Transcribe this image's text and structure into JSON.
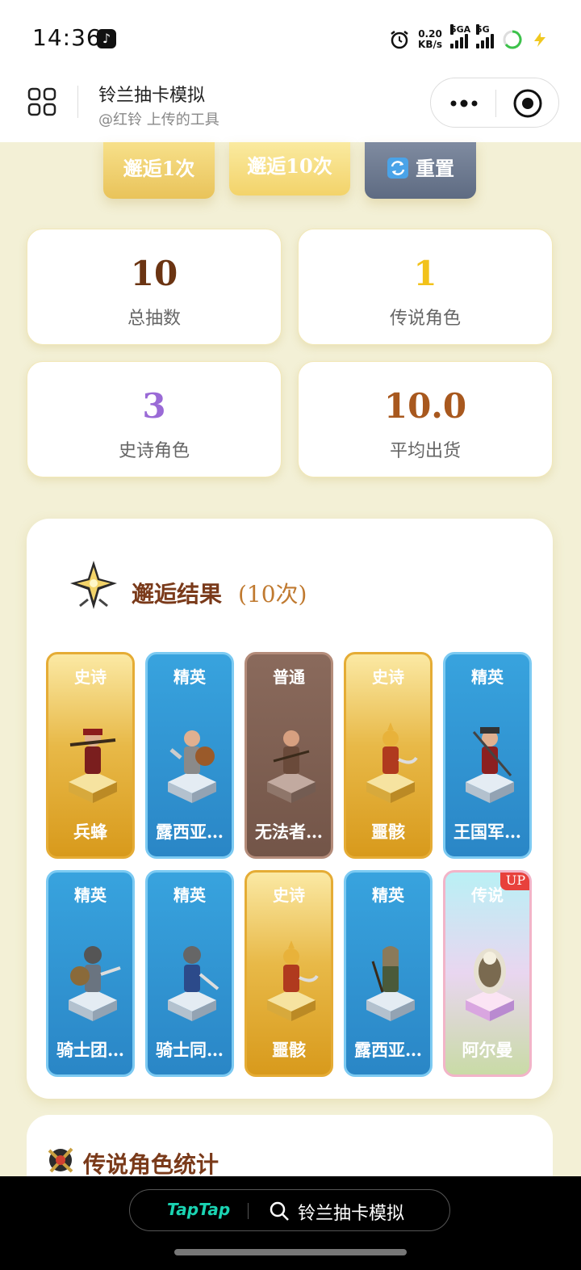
{
  "status_bar": {
    "time": "14:36",
    "net_speed_value": "0.20",
    "net_speed_unit": "KB/s",
    "sig1_label": "5GA",
    "sig2_label": "5G",
    "icons": [
      "tiktok-icon",
      "alarm-icon",
      "signal-icon",
      "battery-icon",
      "charging-icon"
    ]
  },
  "header": {
    "title": "铃兰抽卡模拟",
    "subtitle": "@红铃 上传的工具"
  },
  "actions": {
    "draw_one": "邂逅1次",
    "draw_ten": "邂逅10次",
    "reset": "重置"
  },
  "stats": [
    {
      "value": "10",
      "label": "总抽数",
      "color": "#6b3412"
    },
    {
      "value": "1",
      "label": "传说角色",
      "color": "#f2c21a"
    },
    {
      "value": "3",
      "label": "史诗角色",
      "color": "#9a6ad6"
    },
    {
      "value": "10.0",
      "label": "平均出货",
      "color": "#a8581e"
    }
  ],
  "results": {
    "title": "邂逅结果",
    "count": "(10次)",
    "cards": [
      {
        "rarity": "史诗",
        "name": "兵蜂",
        "tier": "epic"
      },
      {
        "rarity": "精英",
        "name": "露西亚…",
        "tier": "elite"
      },
      {
        "rarity": "普通",
        "name": "无法者…",
        "tier": "common"
      },
      {
        "rarity": "史诗",
        "name": "噩骸",
        "tier": "epic"
      },
      {
        "rarity": "精英",
        "name": "王国军…",
        "tier": "elite"
      },
      {
        "rarity": "精英",
        "name": "骑士团…",
        "tier": "elite"
      },
      {
        "rarity": "精英",
        "name": "骑士同…",
        "tier": "elite"
      },
      {
        "rarity": "史诗",
        "name": "噩骸",
        "tier": "epic"
      },
      {
        "rarity": "精英",
        "name": "露西亚…",
        "tier": "elite"
      },
      {
        "rarity": "传说",
        "name": "阿尔曼",
        "tier": "legend",
        "badge": "UP"
      }
    ]
  },
  "legend_stats": {
    "title": "传说角色统计"
  },
  "bottom_bar": {
    "brand": "TapTap",
    "search_text": "铃兰抽卡模拟"
  }
}
